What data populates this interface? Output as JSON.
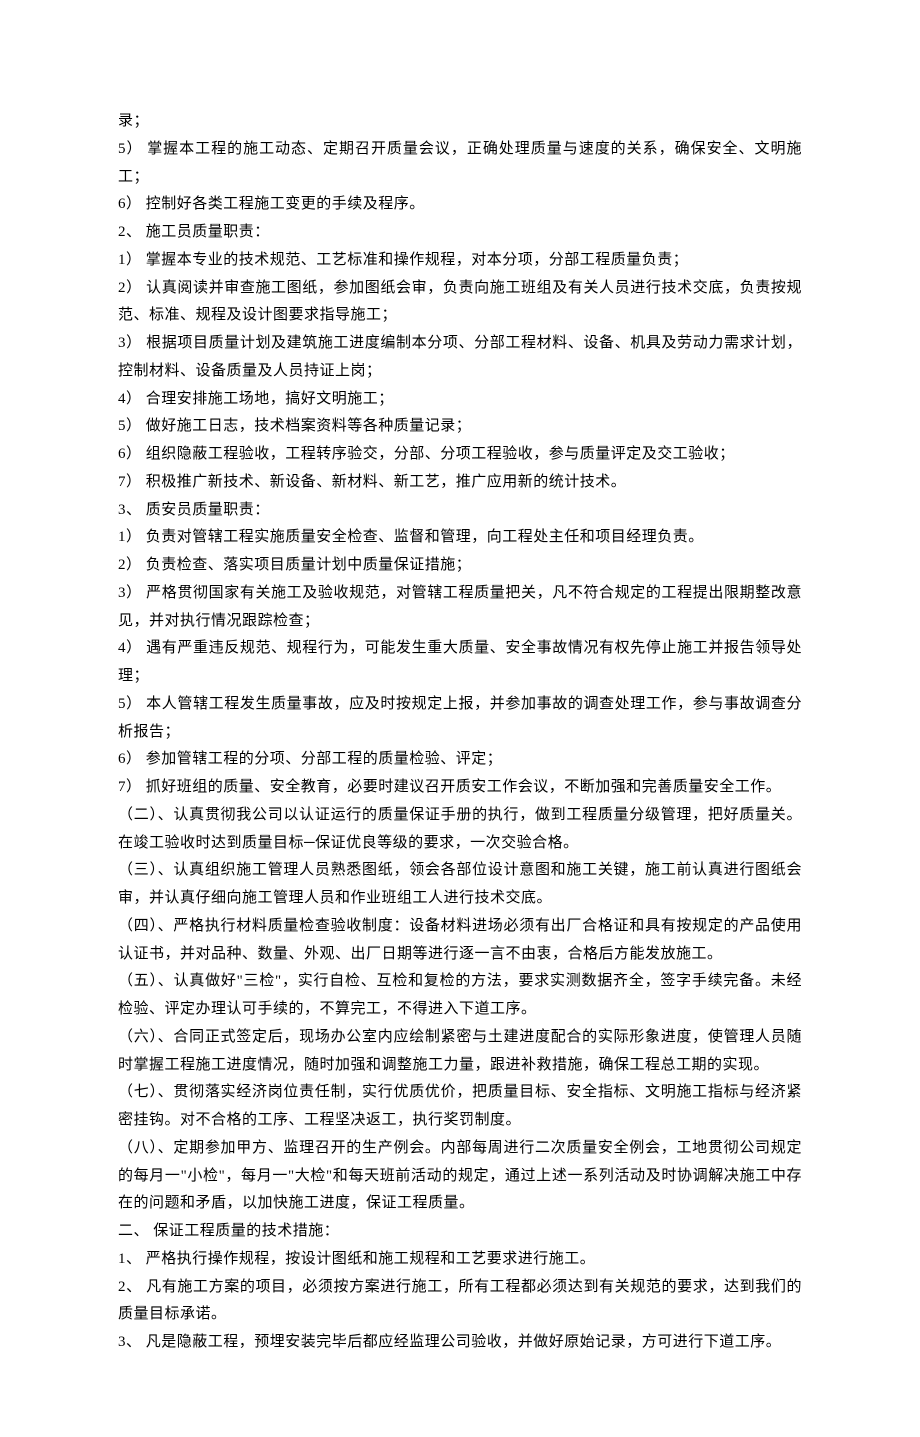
{
  "lines": [
    "录；",
    "5）  掌握本工程的施工动态、定期召开质量会议，正确处理质量与速度的关系，确保安全、文明施工；",
    "6）  控制好各类工程施工变更的手续及程序。",
    "2、  施工员质量职责：",
    "1）  掌握本专业的技术规范、工艺标准和操作规程，对本分项，分部工程质量负责；",
    "2）  认真阅读并审查施工图纸，参加图纸会审，负责向施工班组及有关人员进行技术交底，负责按规范、标准、规程及设计图要求指导施工；",
    "3）  根据项目质量计划及建筑施工进度编制本分项、分部工程材料、设备、机具及劳动力需求计划，控制材料、设备质量及人员持证上岗；",
    "4）  合理安排施工场地，搞好文明施工；",
    "5）  做好施工日志，技术档案资料等各种质量记录；",
    "6）  组织隐蔽工程验收，工程转序验交，分部、分项工程验收，参与质量评定及交工验收；",
    "7）  积极推广新技术、新设备、新材料、新工艺，推广应用新的统计技术。",
    "3、  质安员质量职责：",
    "1）  负责对管辖工程实施质量安全检查、监督和管理，向工程处主任和项目经理负责。",
    "2）  负责检查、落实项目质量计划中质量保证措施；",
    "3）  严格贯彻国家有关施工及验收规范，对管辖工程质量把关，凡不符合规定的工程提出限期整改意见，并对执行情况跟踪检查；",
    "4）  遇有严重违反规范、规程行为，可能发生重大质量、安全事故情况有权先停止施工并报告领导处理；",
    "5）  本人管辖工程发生质量事故，应及时按规定上报，并参加事故的调查处理工作，参与事故调查分析报告；",
    "6）  参加管辖工程的分项、分部工程的质量检验、评定；",
    "7）  抓好班组的质量、安全教育，必要时建议召开质安工作会议，不断加强和完善质量安全工作。",
    "（二）、认真贯彻我公司以认证运行的质量保证手册的执行，做到工程质量分级管理，把好质量关。在竣工验收时达到质量目标─保证优良等级的要求，一次交验合格。",
    "（三）、认真组织施工管理人员熟悉图纸，领会各部位设计意图和施工关键，施工前认真进行图纸会审，并认真仔细向施工管理人员和作业班组工人进行技术交底。",
    "（四）、严格执行材料质量检查验收制度：设备材料进场必须有出厂合格证和具有按规定的产品使用认证书，并对品种、数量、外观、出厂日期等进行逐一言不由衷，合格后方能发放施工。",
    "（五）、认真做好\"三检\"，实行自检、互检和复检的方法，要求实测数据齐全，签字手续完备。未经检验、评定办理认可手续的，不算完工，不得进入下道工序。",
    "（六）、合同正式签定后，现场办公室内应绘制紧密与土建进度配合的实际形象进度，使管理人员随时掌握工程施工进度情况，随时加强和调整施工力量，跟进补救措施，确保工程总工期的实现。",
    "（七）、贯彻落实经济岗位责任制，实行优质优价，把质量目标、安全指标、文明施工指标与经济紧密挂钩。对不合格的工序、工程坚决返工，执行奖罚制度。",
    "（八）、定期参加甲方、监理召开的生产例会。内部每周进行二次质量安全例会，工地贯彻公司规定的每月一\"小检\"，每月一\"大检\"和每天班前活动的规定，通过上述一系列活动及时协调解决施工中存在的问题和矛盾，以加快施工进度，保证工程质量。",
    "二、  保证工程质量的技术措施：",
    "1、  严格执行操作规程，按设计图纸和施工规程和工艺要求进行施工。",
    "2、  凡有施工方案的项目，必须按方案进行施工，所有工程都必须达到有关规范的要求，达到我们的质量目标承诺。",
    "3、  凡是隐蔽工程，预埋安装完毕后都应经监理公司验收，并做好原始记录，方可进行下道工序。"
  ]
}
